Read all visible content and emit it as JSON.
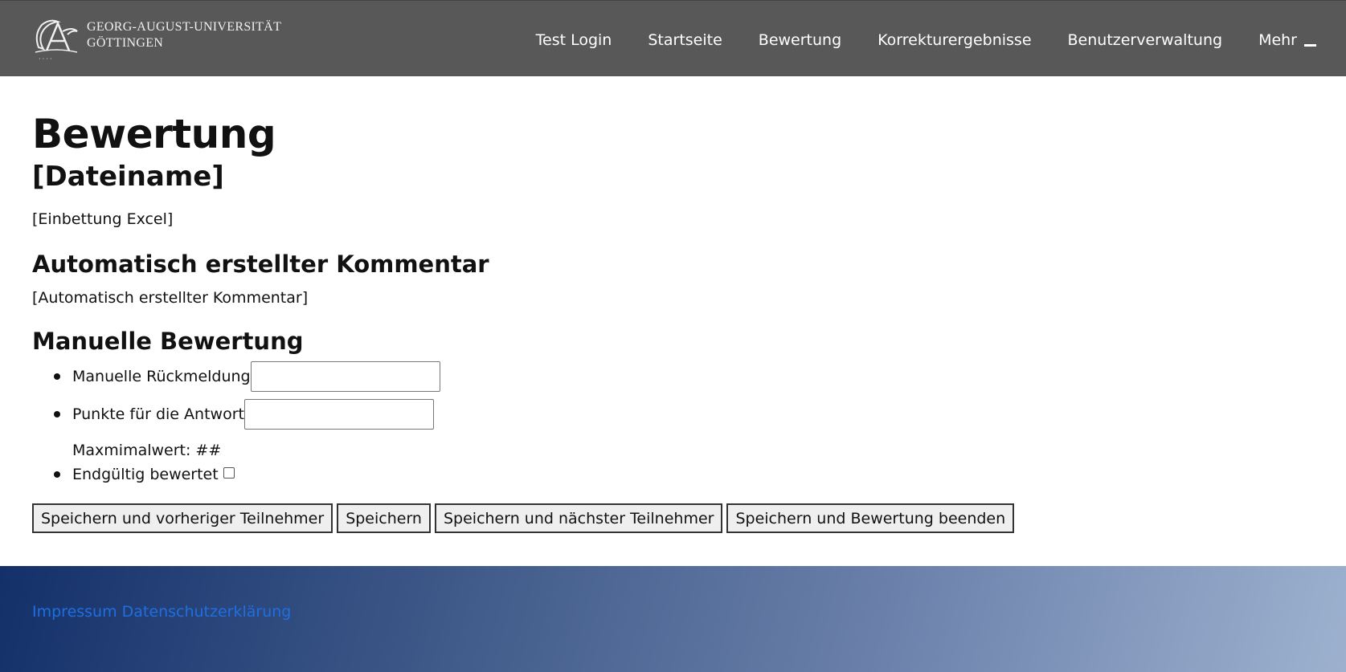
{
  "header": {
    "logo": {
      "line1": "GEORG-AUGUST-UNIVERSITÄT",
      "line2": "GÖTTINGEN",
      "icon": "university-seal-icon"
    },
    "nav": [
      {
        "label": "Test Login"
      },
      {
        "label": "Startseite"
      },
      {
        "label": "Bewertung"
      },
      {
        "label": "Korrekturergebnisse"
      },
      {
        "label": "Benutzerverwaltung"
      },
      {
        "label": "Mehr",
        "icon": "caret-icon"
      }
    ],
    "colors": {
      "background": "#585858",
      "text": "#ffffff"
    }
  },
  "main": {
    "title": "Bewertung",
    "filename": "[Dateiname]",
    "excel_embed": "[Einbettung Excel]",
    "auto_comment": {
      "heading": "Automatisch erstellter Kommentar",
      "text": "[Automatisch erstellter Kommentar]"
    },
    "manual": {
      "heading": "Manuelle Bewertung",
      "feedback_label": "Manuelle Rückmeldung",
      "feedback_value": "",
      "points_label": "Punkte für die Antwort",
      "points_value": "",
      "max_note": "Maxmimalwert: ##",
      "final_label": "Endgültig bewertet",
      "final_checked": false
    },
    "buttons": {
      "prev": "Speichern und vorheriger Teilnehmer",
      "save": "Speichern",
      "next": "Speichern und nächster Teilnehmer",
      "finish": "Speichern und Bewertung beenden"
    }
  },
  "footer": {
    "impressum": "Impressum",
    "privacy": "Datenschutzerklärung",
    "colors": {
      "link": "#1f6fe0",
      "gradient_start": "#14306a",
      "gradient_end": "#9db1cf"
    }
  }
}
